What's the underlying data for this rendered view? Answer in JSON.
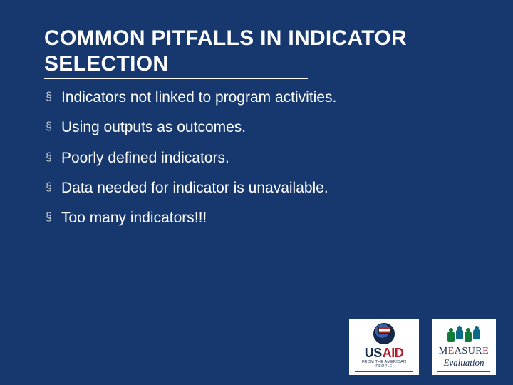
{
  "title_line1": "COMMON PITFALLS IN INDICATOR",
  "title_line2": "SELECTION",
  "bullets": [
    "Indicators not linked to program activities.",
    "Using outputs as outcomes.",
    "Poorly defined indicators.",
    "Data needed for indicator is unavailable.",
    "Too many indicators!!!"
  ],
  "logos": {
    "usaid": {
      "word_left": "US",
      "word_right": "AID",
      "tagline": "FROM THE AMERICAN PEOPLE"
    },
    "measure": {
      "word_plain_left": "M",
      "word_highlight": "E",
      "word_plain_mid": "ASUR",
      "word_highlight2": "E",
      "subtitle": "Evaluation"
    }
  },
  "colors": {
    "background": "#16386f",
    "text": "#ffffff",
    "accent_red": "#b11e2d",
    "accent_navy": "#13294b"
  }
}
